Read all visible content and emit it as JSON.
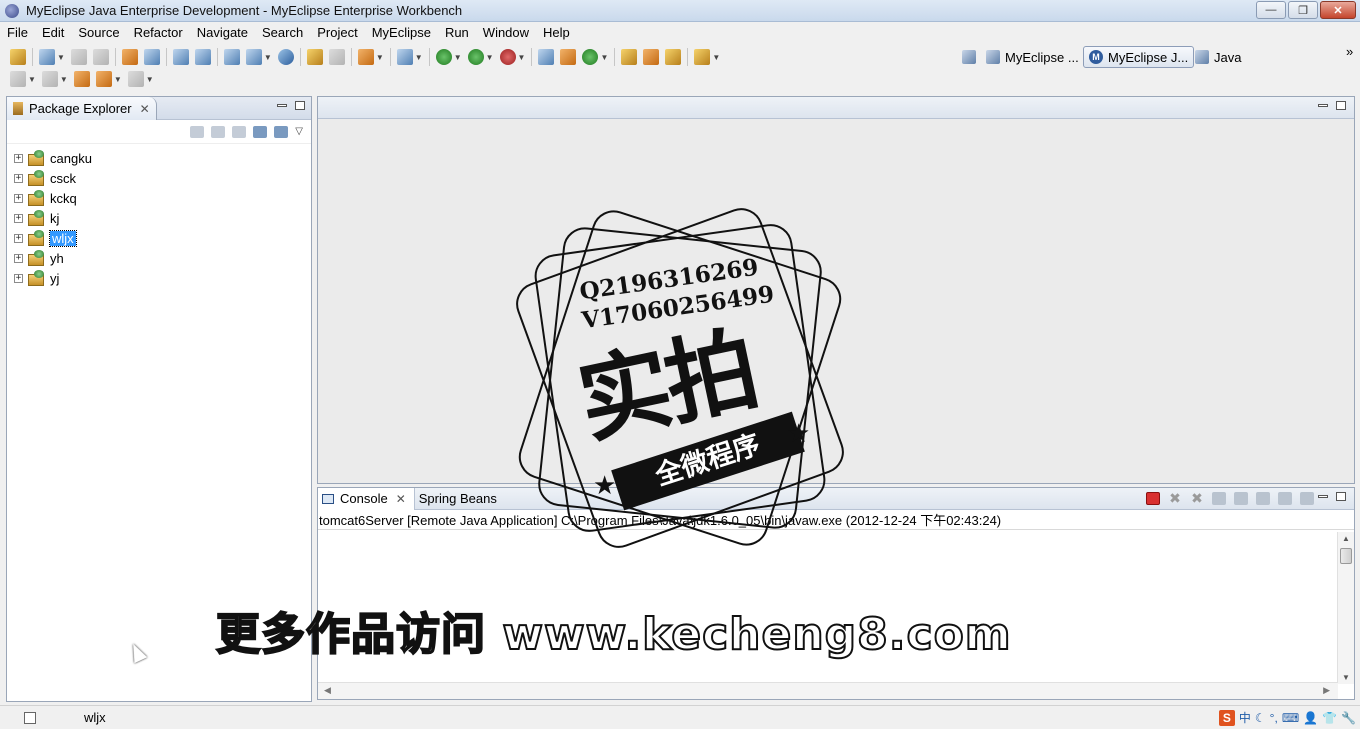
{
  "window": {
    "title": "MyEclipse Java Enterprise Development - MyEclipse Enterprise Workbench",
    "minimize": "—",
    "maximize": "❐",
    "close": "✕"
  },
  "menu": [
    "File",
    "Edit",
    "Source",
    "Refactor",
    "Navigate",
    "Search",
    "Project",
    "MyEclipse",
    "Run",
    "Window",
    "Help"
  ],
  "perspectives": {
    "items": [
      {
        "label": "MyEclipse ...",
        "active": false
      },
      {
        "label": "MyEclipse J...",
        "active": true
      },
      {
        "label": "Java",
        "active": false
      }
    ],
    "overflow": "»"
  },
  "package_explorer": {
    "title": "Package Explorer",
    "close": "✕",
    "projects": [
      {
        "name": "cangku",
        "selected": false
      },
      {
        "name": "csck",
        "selected": false
      },
      {
        "name": "kckq",
        "selected": false
      },
      {
        "name": "kj",
        "selected": false
      },
      {
        "name": "wljx",
        "selected": true
      },
      {
        "name": "yh",
        "selected": false
      },
      {
        "name": "yj",
        "selected": false
      }
    ],
    "expander": "+"
  },
  "console": {
    "tabs": [
      {
        "label": "Console",
        "active": true,
        "closable": true
      },
      {
        "label": "Spring Beans",
        "active": false,
        "closable": false
      }
    ],
    "description": "tomcat6Server [Remote Java Application] C:\\Program Files\\Java\\jdk1.6.0_05\\bin\\javaw.exe (2012-12-24 下午02:43:24)",
    "close": "✕"
  },
  "status": {
    "selected": "wljx"
  },
  "ime": [
    "S",
    "中",
    "☾",
    "°,",
    "⌨",
    "👤",
    "👕",
    "🔧"
  ],
  "watermark": {
    "line1": "Q2196316269",
    "line2": "V17060256499",
    "big": "实拍",
    "band": "全微程序",
    "banner": "更多作品访问 www.kecheng8.com"
  }
}
